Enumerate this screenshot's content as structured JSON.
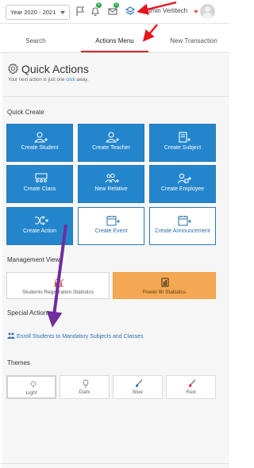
{
  "topbar": {
    "year_select": "Year 2020 - 2021",
    "notifications_badge": "0",
    "messages_badge": "0",
    "user_name": "Admin Vertitech"
  },
  "tabs": [
    {
      "label": "Search"
    },
    {
      "label": "Actions Menu",
      "active": true
    },
    {
      "label": "New Transaction"
    }
  ],
  "quick_actions": {
    "title": "Quick Actions",
    "subtitle_prefix": "Your next action is just one ",
    "subtitle_link": "click",
    "subtitle_suffix": " away."
  },
  "quick_create": {
    "label": "Quick Create",
    "buttons": [
      {
        "label": "Create Student",
        "icon": "user-plus-icon",
        "style": "filled"
      },
      {
        "label": "Create Teacher",
        "icon": "user-plus-icon",
        "style": "filled"
      },
      {
        "label": "Create Subject",
        "icon": "book-plus-icon",
        "style": "filled"
      },
      {
        "label": "Create Class",
        "icon": "class-group-icon",
        "style": "filled"
      },
      {
        "label": "New Relative",
        "icon": "users-plus-icon",
        "style": "filled"
      },
      {
        "label": "Create Employee",
        "icon": "user-lock-plus-icon",
        "style": "filled"
      },
      {
        "label": "Create Action",
        "icon": "shuffle-plus-icon",
        "style": "filled"
      },
      {
        "label": "Create Event",
        "icon": "calendar-plus-icon",
        "style": "outline"
      },
      {
        "label": "Create Announcement",
        "icon": "calendar-plus-icon",
        "style": "outline"
      }
    ]
  },
  "management_views": {
    "label": "Management Views",
    "buttons": [
      {
        "label": "Students Registration Statistics",
        "icon": "bar-chart-icon"
      },
      {
        "label": "Power BI Statistics",
        "icon": "power-bi-icon"
      }
    ]
  },
  "special_actions": {
    "label": "Special Actions",
    "link": "Enroll Students to Mandatory Subjects and Classes"
  },
  "themes": {
    "label": "Themes",
    "options": [
      {
        "label": "Light",
        "icon": "lightbulb-icon",
        "selected": true
      },
      {
        "label": "Dark",
        "icon": "lightbulb-off-icon"
      },
      {
        "label": "Blue",
        "icon": "brush-icon"
      },
      {
        "label": "Red",
        "icon": "brush-icon"
      }
    ]
  },
  "colors": {
    "primary_blue": "#2385cc",
    "accent_red": "#d9232d",
    "powerbi_orange": "#f4a853",
    "annotation_red": "#e8131b",
    "annotation_purple": "#6f2d9e"
  }
}
